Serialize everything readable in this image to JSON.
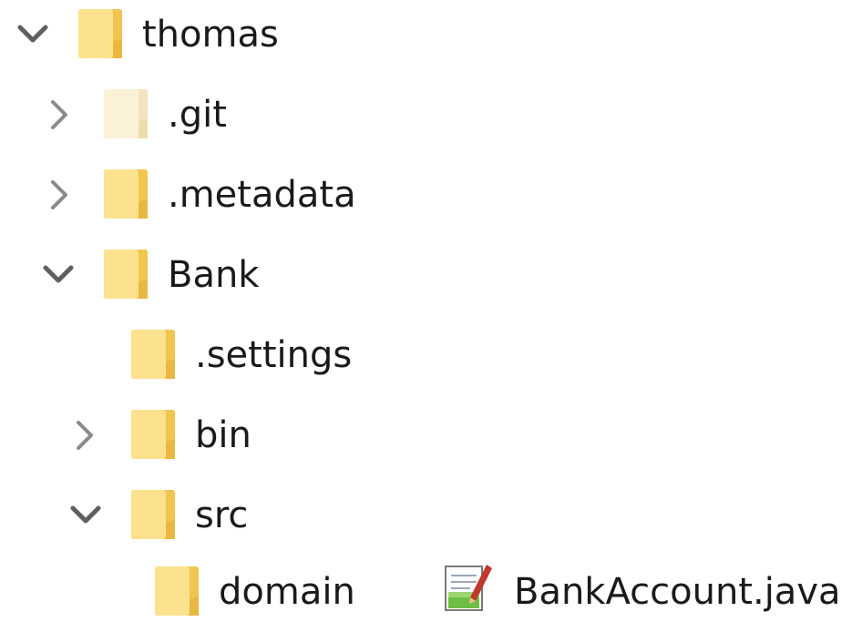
{
  "tree": {
    "items": [
      {
        "label": "thomas",
        "expander": "chevron-down",
        "icon": "folder-icon",
        "depth": 0
      },
      {
        "label": ".git",
        "expander": "chevron-right",
        "icon": "folder-hidden-icon",
        "depth": 1
      },
      {
        "label": ".metadata",
        "expander": "chevron-right",
        "icon": "folder-icon",
        "depth": 1
      },
      {
        "label": "Bank",
        "expander": "chevron-down",
        "icon": "folder-icon",
        "depth": 1
      },
      {
        "label": ".settings",
        "expander": "none",
        "icon": "folder-icon",
        "depth": 2
      },
      {
        "label": "bin",
        "expander": "chevron-right",
        "icon": "folder-icon",
        "depth": 2
      },
      {
        "label": "src",
        "expander": "chevron-down",
        "icon": "folder-icon",
        "depth": 2
      },
      {
        "label": "domain",
        "expander": "none",
        "icon": "folder-icon",
        "depth": 3
      }
    ]
  },
  "file": {
    "label": "BankAccount.java",
    "icon": "java-file-icon"
  },
  "colors": {
    "folder_front": "#FCE28E",
    "folder_back": "#F0C550",
    "folder_hidden": "#FBF1D6",
    "chevron": "#5f5f5f",
    "text": "#1a1a1a"
  }
}
